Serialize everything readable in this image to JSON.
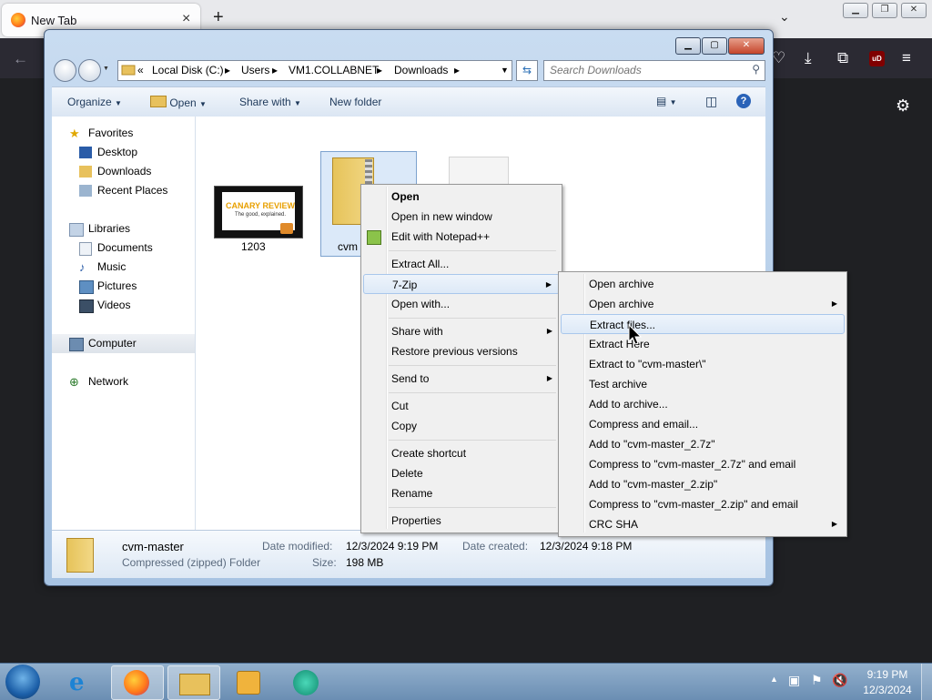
{
  "firefox": {
    "tab_title": "New Tab",
    "tab_close": "×",
    "new_tab": "+",
    "list_tabs": "⌄",
    "ublock_label": "uD"
  },
  "explorer": {
    "breadcrumb": [
      "Local Disk (C:)",
      "Users",
      "VM1.COLLABNET",
      "Downloads"
    ],
    "search_placeholder": "Search Downloads",
    "toolbar": {
      "organize": "Organize",
      "open": "Open",
      "share_with": "Share with",
      "new_folder": "New folder"
    },
    "nav": {
      "favorites": "Favorites",
      "favorites_items": [
        "Desktop",
        "Downloads",
        "Recent Places"
      ],
      "libraries": "Libraries",
      "libraries_items": [
        "Documents",
        "Music",
        "Pictures",
        "Videos"
      ],
      "computer": "Computer",
      "network": "Network"
    },
    "files": [
      {
        "name": "1203",
        "thumb_text": "CANARY REVIEW",
        "thumb_sub": "The good, explained."
      },
      {
        "name": "cvm"
      },
      {
        "name": ""
      }
    ],
    "details": {
      "name": "cvm-master",
      "type": "Compressed (zipped) Folder",
      "modified_label": "Date modified:",
      "modified": "12/3/2024 9:19 PM",
      "created_label": "Date created:",
      "created": "12/3/2024 9:18 PM",
      "size_label": "Size:",
      "size": "198 MB"
    }
  },
  "context_menu": {
    "items": [
      "Open",
      "Open in new window",
      "Edit with Notepad++",
      "Extract All...",
      "7-Zip",
      "Open with...",
      "Share with",
      "Restore previous versions",
      "Send to",
      "Cut",
      "Copy",
      "Create shortcut",
      "Delete",
      "Rename",
      "Properties"
    ]
  },
  "submenu_7zip": {
    "items": [
      "Open archive",
      "Open archive",
      "Extract files...",
      "Extract Here",
      "Extract to \"cvm-master\\\"",
      "Test archive",
      "Add to archive...",
      "Compress and email...",
      "Add to \"cvm-master_2.7z\"",
      "Compress to \"cvm-master_2.7z\" and email",
      "Add to \"cvm-master_2.zip\"",
      "Compress to \"cvm-master_2.zip\" and email",
      "CRC SHA"
    ]
  },
  "taskbar": {
    "time": "9:19 PM",
    "date": "12/3/2024"
  }
}
